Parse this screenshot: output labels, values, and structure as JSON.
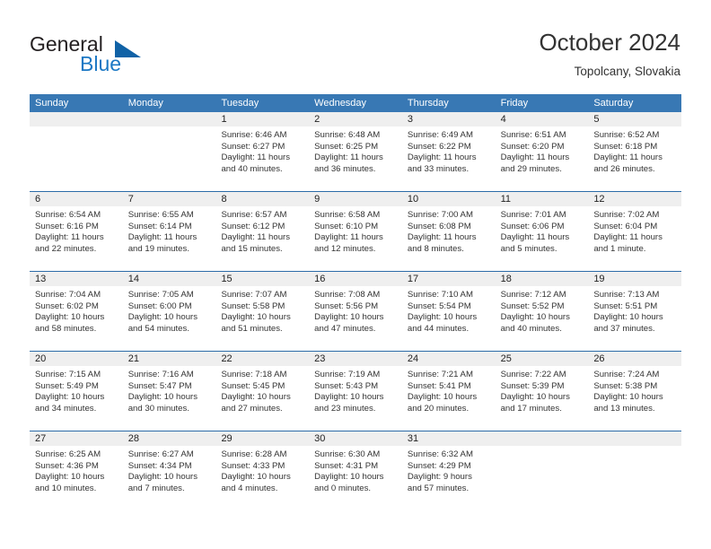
{
  "brand": {
    "name_part1": "General",
    "name_part2": "Blue",
    "triangle_icon": "triangle-icon",
    "accent_color": "#1062a6",
    "text_color": "#231f20"
  },
  "header": {
    "title": "October 2024",
    "subtitle": "Topolcany, Slovakia"
  },
  "calendar": {
    "header_bg": "#3878b4",
    "daynum_bg": "#efefef",
    "separator_color": "#2c6ca8",
    "weekdays": [
      "Sunday",
      "Monday",
      "Tuesday",
      "Wednesday",
      "Thursday",
      "Friday",
      "Saturday"
    ],
    "weeks": [
      [
        {
          "day": "",
          "blank": true,
          "lines": []
        },
        {
          "day": "",
          "blank": true,
          "lines": []
        },
        {
          "day": "1",
          "lines": [
            "Sunrise: 6:46 AM",
            "Sunset: 6:27 PM",
            "Daylight: 11 hours",
            "and 40 minutes."
          ]
        },
        {
          "day": "2",
          "lines": [
            "Sunrise: 6:48 AM",
            "Sunset: 6:25 PM",
            "Daylight: 11 hours",
            "and 36 minutes."
          ]
        },
        {
          "day": "3",
          "lines": [
            "Sunrise: 6:49 AM",
            "Sunset: 6:22 PM",
            "Daylight: 11 hours",
            "and 33 minutes."
          ]
        },
        {
          "day": "4",
          "lines": [
            "Sunrise: 6:51 AM",
            "Sunset: 6:20 PM",
            "Daylight: 11 hours",
            "and 29 minutes."
          ]
        },
        {
          "day": "5",
          "lines": [
            "Sunrise: 6:52 AM",
            "Sunset: 6:18 PM",
            "Daylight: 11 hours",
            "and 26 minutes."
          ]
        }
      ],
      [
        {
          "day": "6",
          "lines": [
            "Sunrise: 6:54 AM",
            "Sunset: 6:16 PM",
            "Daylight: 11 hours",
            "and 22 minutes."
          ]
        },
        {
          "day": "7",
          "lines": [
            "Sunrise: 6:55 AM",
            "Sunset: 6:14 PM",
            "Daylight: 11 hours",
            "and 19 minutes."
          ]
        },
        {
          "day": "8",
          "lines": [
            "Sunrise: 6:57 AM",
            "Sunset: 6:12 PM",
            "Daylight: 11 hours",
            "and 15 minutes."
          ]
        },
        {
          "day": "9",
          "lines": [
            "Sunrise: 6:58 AM",
            "Sunset: 6:10 PM",
            "Daylight: 11 hours",
            "and 12 minutes."
          ]
        },
        {
          "day": "10",
          "lines": [
            "Sunrise: 7:00 AM",
            "Sunset: 6:08 PM",
            "Daylight: 11 hours",
            "and 8 minutes."
          ]
        },
        {
          "day": "11",
          "lines": [
            "Sunrise: 7:01 AM",
            "Sunset: 6:06 PM",
            "Daylight: 11 hours",
            "and 5 minutes."
          ]
        },
        {
          "day": "12",
          "lines": [
            "Sunrise: 7:02 AM",
            "Sunset: 6:04 PM",
            "Daylight: 11 hours",
            "and 1 minute."
          ]
        }
      ],
      [
        {
          "day": "13",
          "lines": [
            "Sunrise: 7:04 AM",
            "Sunset: 6:02 PM",
            "Daylight: 10 hours",
            "and 58 minutes."
          ]
        },
        {
          "day": "14",
          "lines": [
            "Sunrise: 7:05 AM",
            "Sunset: 6:00 PM",
            "Daylight: 10 hours",
            "and 54 minutes."
          ]
        },
        {
          "day": "15",
          "lines": [
            "Sunrise: 7:07 AM",
            "Sunset: 5:58 PM",
            "Daylight: 10 hours",
            "and 51 minutes."
          ]
        },
        {
          "day": "16",
          "lines": [
            "Sunrise: 7:08 AM",
            "Sunset: 5:56 PM",
            "Daylight: 10 hours",
            "and 47 minutes."
          ]
        },
        {
          "day": "17",
          "lines": [
            "Sunrise: 7:10 AM",
            "Sunset: 5:54 PM",
            "Daylight: 10 hours",
            "and 44 minutes."
          ]
        },
        {
          "day": "18",
          "lines": [
            "Sunrise: 7:12 AM",
            "Sunset: 5:52 PM",
            "Daylight: 10 hours",
            "and 40 minutes."
          ]
        },
        {
          "day": "19",
          "lines": [
            "Sunrise: 7:13 AM",
            "Sunset: 5:51 PM",
            "Daylight: 10 hours",
            "and 37 minutes."
          ]
        }
      ],
      [
        {
          "day": "20",
          "lines": [
            "Sunrise: 7:15 AM",
            "Sunset: 5:49 PM",
            "Daylight: 10 hours",
            "and 34 minutes."
          ]
        },
        {
          "day": "21",
          "lines": [
            "Sunrise: 7:16 AM",
            "Sunset: 5:47 PM",
            "Daylight: 10 hours",
            "and 30 minutes."
          ]
        },
        {
          "day": "22",
          "lines": [
            "Sunrise: 7:18 AM",
            "Sunset: 5:45 PM",
            "Daylight: 10 hours",
            "and 27 minutes."
          ]
        },
        {
          "day": "23",
          "lines": [
            "Sunrise: 7:19 AM",
            "Sunset: 5:43 PM",
            "Daylight: 10 hours",
            "and 23 minutes."
          ]
        },
        {
          "day": "24",
          "lines": [
            "Sunrise: 7:21 AM",
            "Sunset: 5:41 PM",
            "Daylight: 10 hours",
            "and 20 minutes."
          ]
        },
        {
          "day": "25",
          "lines": [
            "Sunrise: 7:22 AM",
            "Sunset: 5:39 PM",
            "Daylight: 10 hours",
            "and 17 minutes."
          ]
        },
        {
          "day": "26",
          "lines": [
            "Sunrise: 7:24 AM",
            "Sunset: 5:38 PM",
            "Daylight: 10 hours",
            "and 13 minutes."
          ]
        }
      ],
      [
        {
          "day": "27",
          "lines": [
            "Sunrise: 6:25 AM",
            "Sunset: 4:36 PM",
            "Daylight: 10 hours",
            "and 10 minutes."
          ]
        },
        {
          "day": "28",
          "lines": [
            "Sunrise: 6:27 AM",
            "Sunset: 4:34 PM",
            "Daylight: 10 hours",
            "and 7 minutes."
          ]
        },
        {
          "day": "29",
          "lines": [
            "Sunrise: 6:28 AM",
            "Sunset: 4:33 PM",
            "Daylight: 10 hours",
            "and 4 minutes."
          ]
        },
        {
          "day": "30",
          "lines": [
            "Sunrise: 6:30 AM",
            "Sunset: 4:31 PM",
            "Daylight: 10 hours",
            "and 0 minutes."
          ]
        },
        {
          "day": "31",
          "lines": [
            "Sunrise: 6:32 AM",
            "Sunset: 4:29 PM",
            "Daylight: 9 hours",
            "and 57 minutes."
          ]
        },
        {
          "day": "",
          "blank": true,
          "lines": []
        },
        {
          "day": "",
          "blank": true,
          "lines": []
        }
      ]
    ]
  }
}
